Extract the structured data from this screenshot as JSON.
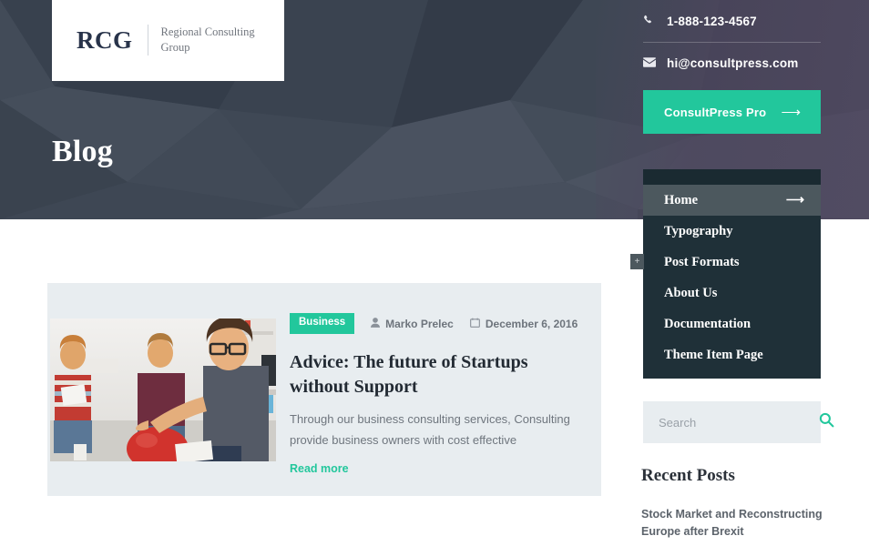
{
  "brand": {
    "mark": "RCG",
    "name": "Regional Consulting Group"
  },
  "hero": {
    "page_title": "Blog"
  },
  "header": {
    "phone": "1-888-123-4567",
    "phone_icon": "phone-icon",
    "email": "hi@consultpress.com",
    "email_icon": "envelope-icon",
    "cta_label": "ConsultPress Pro",
    "cta_arrow": "arrow-right-icon"
  },
  "nav": {
    "items": [
      {
        "label": "Home",
        "active": true,
        "arrow": "arrow-right-icon"
      },
      {
        "label": "Typography",
        "active": false
      },
      {
        "label": "Post Formats",
        "active": false,
        "toggle": "+"
      },
      {
        "label": "About Us",
        "active": false
      },
      {
        "label": "Documentation",
        "active": false
      },
      {
        "label": "Theme Item Page",
        "active": false
      }
    ]
  },
  "search": {
    "placeholder": "Search",
    "value": "",
    "icon": "search-icon"
  },
  "sidebar": {
    "recent_posts_title": "Recent Posts",
    "recent_posts": [
      "Stock Market and Reconstructing Europe after Brexit"
    ]
  },
  "post": {
    "category": "Business",
    "author": "Marko Prelec",
    "author_icon": "user-icon",
    "date": "December 6, 2016",
    "date_icon": "calendar-icon",
    "title": "Advice: The future of Startups without Support",
    "excerpt": "Through our business consulting services, Consulting provide business owners with cost effective",
    "read_more": "Read more",
    "thumbnail_alt": "three-people-meeting-photo"
  },
  "colors": {
    "accent_green": "#22c79c",
    "hero_dark": "#3b4350",
    "nav_dark": "#1f3038",
    "card_bg": "#e8edf0"
  }
}
